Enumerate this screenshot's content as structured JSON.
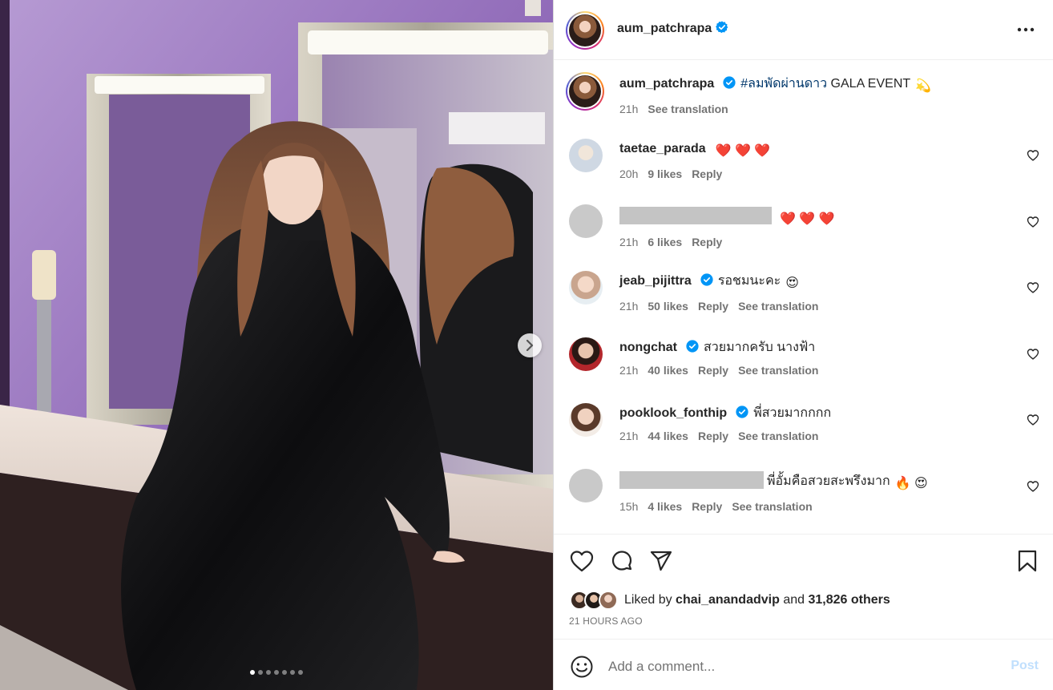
{
  "post": {
    "author": "aum_patchrapa",
    "caption_hashtag": "#ลมพัดผ่านดาว",
    "caption_text": " GALA EVENT",
    "caption_emoji": "💫",
    "caption_time": "21h",
    "see_translation": "See translation"
  },
  "media": {
    "image_count": 7,
    "active_index": 0
  },
  "comments": [
    {
      "username": "taetae_parada",
      "verified": false,
      "text": "",
      "emoji": "❤️ ❤️ ❤️",
      "time": "20h",
      "likes": "9 likes",
      "reply": "Reply",
      "translate": "",
      "redacted": false
    },
    {
      "username": "",
      "verified": false,
      "text": "",
      "emoji": "❤️ ❤️ ❤️",
      "time": "21h",
      "likes": "6 likes",
      "reply": "Reply",
      "translate": "",
      "redacted": true
    },
    {
      "username": "jeab_pijittra",
      "verified": true,
      "text": "รอชมนะคะ",
      "emoji": "😍",
      "time": "21h",
      "likes": "50 likes",
      "reply": "Reply",
      "translate": "See translation",
      "redacted": false
    },
    {
      "username": "nongchat",
      "verified": true,
      "text": "สวยมากครับ นางฟ้า",
      "emoji": "",
      "time": "21h",
      "likes": "40 likes",
      "reply": "Reply",
      "translate": "See translation",
      "redacted": false
    },
    {
      "username": "pooklook_fonthip",
      "verified": true,
      "text": "พี่สวยมากกกก",
      "emoji": "",
      "time": "21h",
      "likes": "44 likes",
      "reply": "Reply",
      "translate": "See translation",
      "redacted": false
    },
    {
      "username": "",
      "verified": false,
      "text": "พี่อั้มคือสวยสะพรึงมาก",
      "emoji": "🔥 😍",
      "time": "15h",
      "likes": "4 likes",
      "reply": "Reply",
      "translate": "See translation",
      "redacted": true
    }
  ],
  "likes": {
    "prefix": "Liked by ",
    "liker": "chai_anandadvip",
    "middle": " and ",
    "others": "31,826 others",
    "time_ago": "21 HOURS AGO"
  },
  "composer": {
    "placeholder": "Add a comment...",
    "post_label": "Post"
  },
  "colors": {
    "verified": "#0095f6",
    "link": "#00376b",
    "muted": "#737373",
    "post_disabled": "#c0dffd"
  },
  "icons": {
    "header_more": "more-horizontal-icon",
    "like": "heart-icon",
    "comment": "comment-icon",
    "share": "share-icon",
    "save": "bookmark-icon",
    "emoji": "emoji-icon",
    "next": "chevron-right-icon",
    "verified": "verified-badge-icon"
  }
}
